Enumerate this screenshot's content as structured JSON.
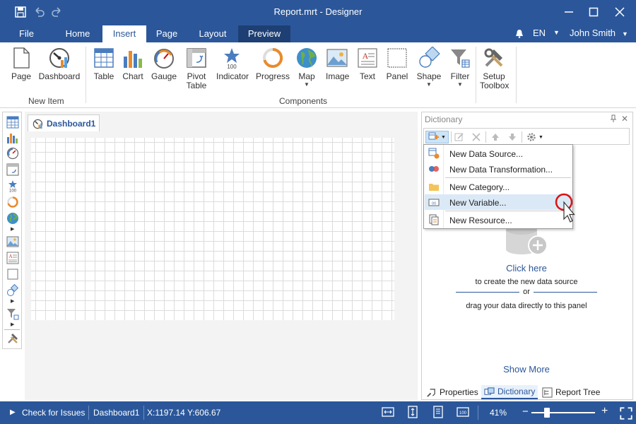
{
  "window": {
    "title": "Report.mrt - Designer"
  },
  "tabs": [
    "File",
    "Home",
    "Insert",
    "Page",
    "Layout",
    "Preview"
  ],
  "user": {
    "language": "EN",
    "name": "John Smith"
  },
  "ribbon": {
    "new_item": {
      "label": "New Item",
      "buttons": [
        "Page",
        "Dashboard"
      ]
    },
    "components": {
      "label": "Components",
      "buttons": [
        "Table",
        "Chart",
        "Gauge",
        "Pivot",
        "Table",
        "Indicator",
        "Progress",
        "Map",
        "Image",
        "Text",
        "Panel",
        "Shape",
        "Filter"
      ]
    },
    "setup_toolbox": [
      "Setup",
      "Toolbox"
    ],
    "indicator_value": "100"
  },
  "document": {
    "tab": "Dashboard1"
  },
  "dictionary": {
    "title": "Dictionary",
    "menu": [
      "New Data Source...",
      "New Data Transformation...",
      "New Category...",
      "New Variable...",
      "New Resource..."
    ],
    "click_here": "Click here",
    "create_text": "to create the new data source",
    "or_text": "or",
    "drag_text": "drag your data directly to this panel",
    "show_more": "Show More",
    "panel_tabs": [
      "Properties",
      "Dictionary",
      "Report Tree"
    ]
  },
  "status": {
    "check": "Check for Issues",
    "page": "Dashboard1",
    "coords": "X:1197.14 Y:606.67",
    "zoom": "41%",
    "zoom_level": 0.41,
    "minus": "−",
    "plus": "+"
  },
  "toolbox_indicator": "100",
  "colors": {
    "accent": "#2b579a",
    "preview_tab": "#1e3f73",
    "hover": "#dbe9f7"
  }
}
